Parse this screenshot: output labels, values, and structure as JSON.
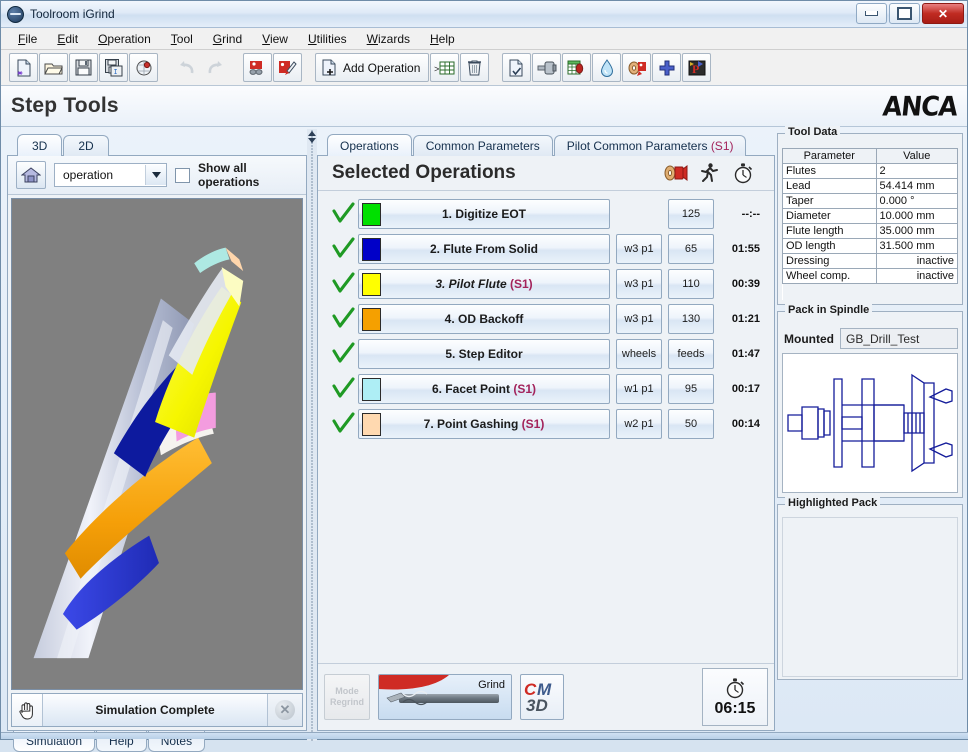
{
  "window": {
    "title": "Toolroom iGrind",
    "icon": "app-icon",
    "buttons": {
      "minimize": "minimize",
      "maximize": "restore",
      "close": "✕"
    }
  },
  "menubar": {
    "items": [
      {
        "label": "File",
        "mnemonic": "F"
      },
      {
        "label": "Edit",
        "mnemonic": "E"
      },
      {
        "label": "Operation",
        "mnemonic": "O"
      },
      {
        "label": "Tool",
        "mnemonic": "T"
      },
      {
        "label": "Grind",
        "mnemonic": "G"
      },
      {
        "label": "View",
        "mnemonic": "V"
      },
      {
        "label": "Utilities",
        "mnemonic": "U"
      },
      {
        "label": "Wizards",
        "mnemonic": "W"
      },
      {
        "label": "Help",
        "mnemonic": "H"
      }
    ]
  },
  "toolbar": {
    "add_operation_label": "Add Operation",
    "icons": [
      "new-document-icon",
      "open-folder-icon",
      "save-icon",
      "save-as-icon",
      "print-preview-icon",
      "undo-icon",
      "redo-icon",
      "wheel-pack-icon",
      "dress-wheel-icon",
      "add-operation-icon",
      "grid-icon",
      "delete-icon",
      "new-tool-icon",
      "spindle-icon",
      "table-wheel-icon",
      "coolant-icon",
      "wheel-set-icon",
      "add-icon",
      "post-icon"
    ]
  },
  "header": {
    "page_title": "Step Tools",
    "logo": "ANCA"
  },
  "left_panel": {
    "tabs": [
      {
        "label": "3D",
        "active": true
      },
      {
        "label": "2D",
        "active": false
      }
    ],
    "home_icon": "home-view-icon",
    "operation_combo": {
      "value": "operation",
      "options": [
        "operation"
      ]
    },
    "show_all_label": "Show all operations",
    "show_all_checked": false,
    "viewport_name": "3d-tool-viewport",
    "status": {
      "hand_icon": "pan-hand-icon",
      "text": "Simulation Complete",
      "close_icon": "✕"
    },
    "bottom_tabs": [
      {
        "label": "Simulation",
        "active": true
      },
      {
        "label": "Help",
        "active": false
      },
      {
        "label": "Notes",
        "active": false
      }
    ]
  },
  "main": {
    "tabs": [
      {
        "label": "Operations",
        "suffix": "",
        "active": true
      },
      {
        "label": "Common Parameters",
        "suffix": "",
        "active": false
      },
      {
        "label": "Pilot Common Parameters",
        "suffix": "(S1)",
        "active": false
      }
    ],
    "section_title": "Selected Operations",
    "header_icons": [
      "wheel-pack-icon",
      "run-simulation-icon",
      "stopwatch-icon"
    ],
    "operations": [
      {
        "num": "1.",
        "name": "Digitize EOT",
        "suffix": "",
        "italic": false,
        "color": "#00e000",
        "wheel": "",
        "feed": "125",
        "time": "--:--"
      },
      {
        "num": "2.",
        "name": "Flute From Solid",
        "suffix": "",
        "italic": false,
        "color": "#0000c8",
        "wheel": "w3 p1",
        "feed": "65",
        "time": "01:55"
      },
      {
        "num": "3.",
        "name": "Pilot Flute",
        "suffix": "(S1)",
        "italic": true,
        "color": "#ffff00",
        "wheel": "w3 p1",
        "feed": "110",
        "time": "00:39"
      },
      {
        "num": "4.",
        "name": "OD Backoff",
        "suffix": "",
        "italic": false,
        "color": "#f5a000",
        "wheel": "w3 p1",
        "feed": "130",
        "time": "01:21"
      },
      {
        "num": "5.",
        "name": "Step Editor",
        "suffix": "",
        "italic": false,
        "color": "",
        "wheel": "wheels",
        "feed": "feeds",
        "time": "01:47"
      },
      {
        "num": "6.",
        "name": "Facet Point",
        "suffix": "(S1)",
        "italic": false,
        "color": "#aeeef5",
        "wheel": "w1 p1",
        "feed": "95",
        "time": "00:17"
      },
      {
        "num": "7.",
        "name": "Point Gashing",
        "suffix": "(S1)",
        "italic": false,
        "color": "#ffd9b0",
        "wheel": "w2 p1",
        "feed": "50",
        "time": "00:14"
      }
    ],
    "footer": {
      "regrind_line1": "Mode",
      "regrind_line2": "Regrind",
      "grind_label": "Grind",
      "cim_label": "CIM3D",
      "timer_icon": "stopwatch-icon",
      "timer_value": "06:15"
    }
  },
  "right_panel": {
    "tool_data": {
      "title": "Tool Data",
      "columns": [
        "Parameter",
        "Value"
      ],
      "rows": [
        {
          "parameter": "Flutes",
          "value": "2",
          "align": "left"
        },
        {
          "parameter": "Lead",
          "value": "54.414 mm",
          "align": "left"
        },
        {
          "parameter": "Taper",
          "value": "0.000 °",
          "align": "left"
        },
        {
          "parameter": "Diameter",
          "value": "10.000 mm",
          "align": "left"
        },
        {
          "parameter": "Flute length",
          "value": "35.000 mm",
          "align": "left"
        },
        {
          "parameter": "OD length",
          "value": "31.500 mm",
          "align": "left"
        },
        {
          "parameter": "Dressing",
          "value": "inactive",
          "align": "right"
        },
        {
          "parameter": "Wheel comp.",
          "value": "inactive",
          "align": "right"
        }
      ]
    },
    "pack_in_spindle": {
      "title": "Pack in Spindle",
      "mounted_label": "Mounted",
      "mounted_value": "GB_Drill_Test",
      "diagram": "wheel-pack-diagram"
    },
    "highlighted_pack": {
      "title": "Highlighted Pack"
    }
  },
  "colors": {
    "accent": "#a3235b",
    "panel": "#eef2f6",
    "border": "#93a9c0",
    "viewport_bg": "#808080"
  }
}
